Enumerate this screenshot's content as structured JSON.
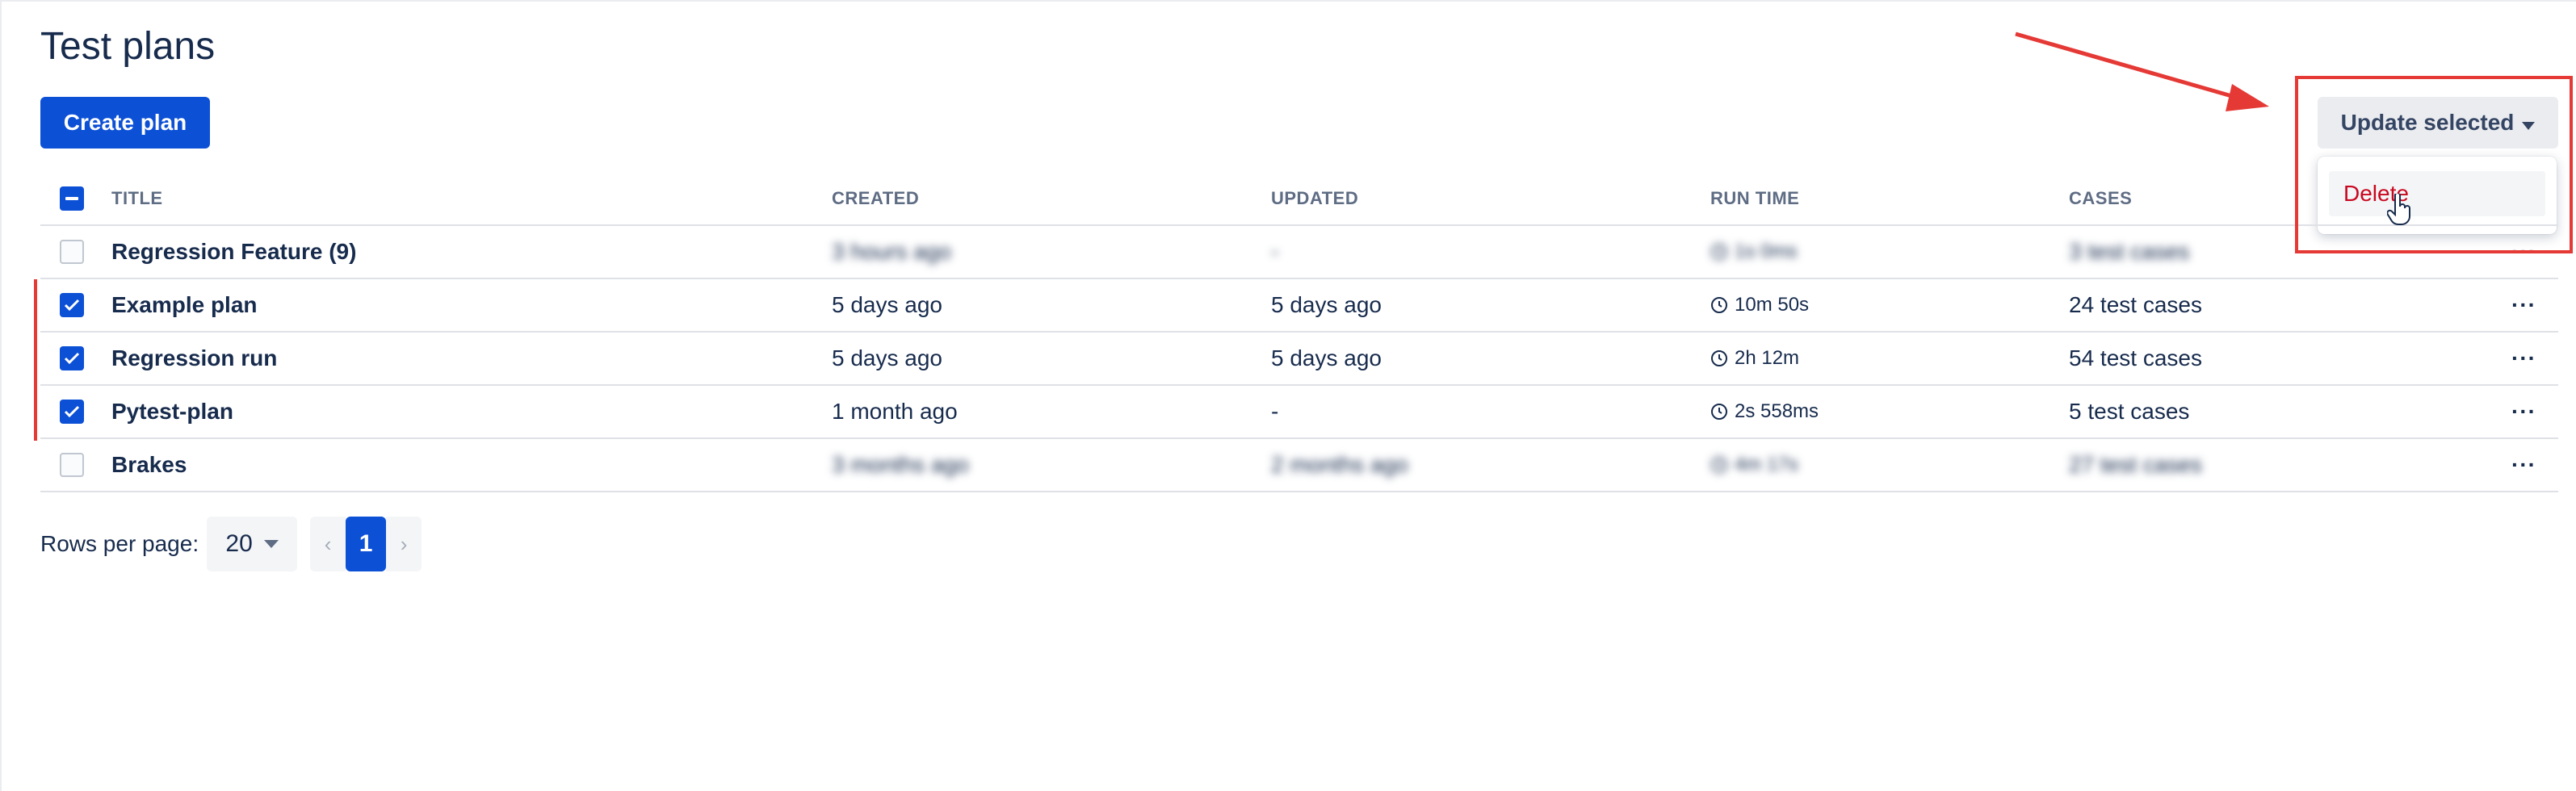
{
  "page": {
    "title": "Test plans"
  },
  "actions": {
    "create_label": "Create plan",
    "update_label": "Update selected"
  },
  "dropdown": {
    "items": [
      {
        "label": "Delete"
      }
    ]
  },
  "table": {
    "headers": {
      "title": "TITLE",
      "created": "CREATED",
      "updated": "UPDATED",
      "run_time": "RUN TIME",
      "cases": "CASES"
    },
    "rows": [
      {
        "title": "Regression Feature (9)",
        "created": "3 hours ago",
        "updated": "-",
        "run_time": "1s 0ms",
        "cases": "3 test cases",
        "checked": false,
        "blurred": true
      },
      {
        "title": "Example plan",
        "created": "5 days ago",
        "updated": "5 days ago",
        "run_time": "10m 50s",
        "cases": "24 test cases",
        "checked": true,
        "blurred": false
      },
      {
        "title": "Regression run",
        "created": "5 days ago",
        "updated": "5 days ago",
        "run_time": "2h 12m",
        "cases": "54 test cases",
        "checked": true,
        "blurred": false
      },
      {
        "title": "Pytest-plan",
        "created": "1 month ago",
        "updated": "-",
        "run_time": "2s 558ms",
        "cases": "5 test cases",
        "checked": true,
        "blurred": false
      },
      {
        "title": "Brakes",
        "created": "3 months ago",
        "updated": "2 months ago",
        "run_time": "4m 17s",
        "cases": "27 test cases",
        "checked": false,
        "blurred": true
      }
    ],
    "row_menu_glyph": "···"
  },
  "pagination": {
    "rows_label": "Rows per page:",
    "rows_value": "20",
    "prev": "‹",
    "current": "1",
    "next": "›"
  },
  "colors": {
    "primary": "#0c50d6",
    "danger": "#c9081f",
    "annotation": "#e53935"
  }
}
